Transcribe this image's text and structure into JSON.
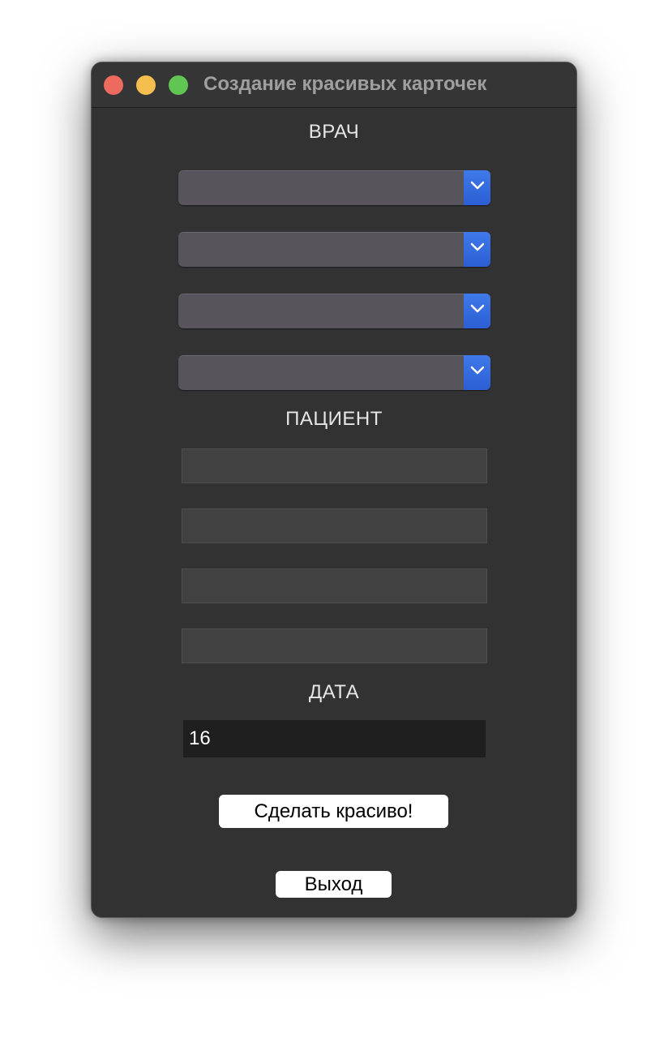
{
  "window": {
    "title": "Создание красивых карточек"
  },
  "doctor_section": {
    "label": "ВРАЧ",
    "combos": [
      {
        "value": ""
      },
      {
        "value": ""
      },
      {
        "value": ""
      },
      {
        "value": ""
      }
    ]
  },
  "patient_section": {
    "label": "ПАЦИЕНТ",
    "fields": [
      {
        "value": ""
      },
      {
        "value": ""
      },
      {
        "value": ""
      },
      {
        "value": ""
      }
    ]
  },
  "date_section": {
    "label": "ДАТА",
    "value": "16"
  },
  "buttons": {
    "make_pretty": "Сделать красиво!",
    "exit": "Выход"
  },
  "colors": {
    "window_bg": "#323232",
    "combo_bg": "#57545b",
    "combo_button": "#2f66da",
    "entry_bg": "#414141",
    "date_bg": "#1f1f1f",
    "close": "#ed6a5e",
    "minimize": "#f4bf4f",
    "maximize": "#61c554"
  },
  "icons": {
    "combo_arrow": "chevron-down-icon"
  }
}
